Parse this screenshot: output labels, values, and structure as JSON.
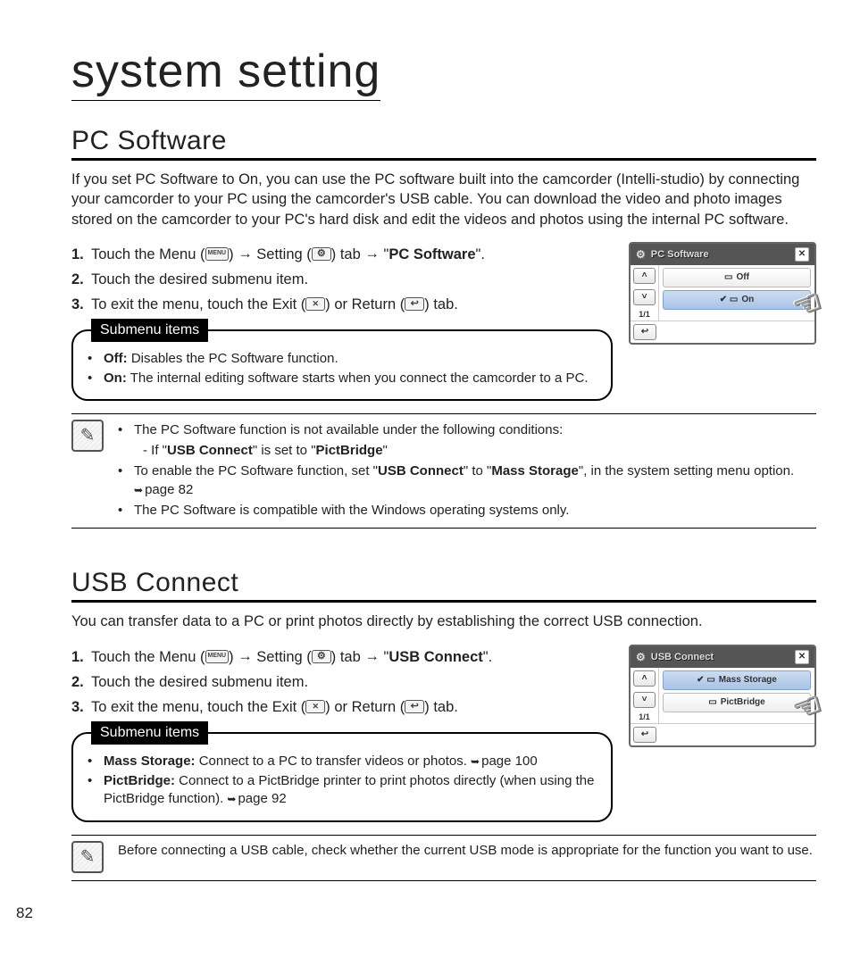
{
  "page": {
    "number": "82",
    "title": "system setting"
  },
  "pc_software": {
    "heading": "PC Software",
    "intro": "If you set PC Software to On, you can use the PC software built into the camcorder (Intelli-studio) by connecting your camcorder to your PC using the camcorder's USB cable. You can download the video and photo images stored on the camcorder to your PC's hard disk and edit the videos and photos using the internal PC software.",
    "steps": {
      "s1_pre": "Touch the Menu (",
      "s1_menu": "MENU",
      "s1_mid1": ") ",
      "s1_arrow": "→",
      "s1_mid2": " Setting (",
      "s1_mid3": ") tab ",
      "s1_target": "PC Software",
      "s2": "Touch the desired submenu item.",
      "s3_pre": "To exit the menu, touch the Exit (",
      "s3_mid": ") or Return (",
      "s3_post": ") tab."
    },
    "submenu_label": "Submenu items",
    "submenu": [
      {
        "term": "Off:",
        "desc": " Disables the PC Software function."
      },
      {
        "term": "On:",
        "desc": " The internal editing software starts when you connect the camcorder to a PC."
      }
    ],
    "notes": {
      "n1": "The PC Software function is not available under the following conditions:",
      "n1_sub_pre": "-  If \"",
      "n1_sub_b1": "USB Connect",
      "n1_sub_mid": "\" is set to \"",
      "n1_sub_b2": "PictBridge",
      "n1_sub_post": "\"",
      "n2_pre": "To enable the PC Software function, set \"",
      "n2_b1": "USB Connect",
      "n2_mid": "\" to \"",
      "n2_b2": "Mass Storage",
      "n2_post": "\", in the system setting menu option. ",
      "n2_ref": "page 82",
      "n3": "The PC Software is compatible with the Windows operating systems only."
    },
    "screen": {
      "title": "PC Software",
      "item_off": "Off",
      "item_on": "On",
      "page": "1/1"
    }
  },
  "usb_connect": {
    "heading": "USB Connect",
    "intro": "You can transfer data to a PC or print photos directly by establishing the correct USB connection.",
    "steps": {
      "s1_pre": "Touch the Menu (",
      "s1_menu": "MENU",
      "s1_mid1": ") ",
      "s1_arrow": "→",
      "s1_mid2": " Setting (",
      "s1_mid3": ") tab ",
      "s1_target": "USB Connect",
      "s2": "Touch the desired submenu item.",
      "s3_pre": "To exit the menu, touch the Exit (",
      "s3_mid": ") or Return (",
      "s3_post": ") tab."
    },
    "submenu_label": "Submenu items",
    "submenu": [
      {
        "term": "Mass Storage:",
        "desc": " Connect to a PC to transfer videos or photos. ",
        "ref": "page 100"
      },
      {
        "term": "PictBridge:",
        "desc": " Connect to a PictBridge printer to print photos directly (when using the PictBridge function). ",
        "ref": "page 92"
      }
    ],
    "note": "Before connecting a USB cable, check whether the current USB mode is appropriate for the function you want to use.",
    "screen": {
      "title": "USB Connect",
      "item_mass": "Mass Storage",
      "item_pict": "PictBridge",
      "page": "1/1"
    }
  }
}
